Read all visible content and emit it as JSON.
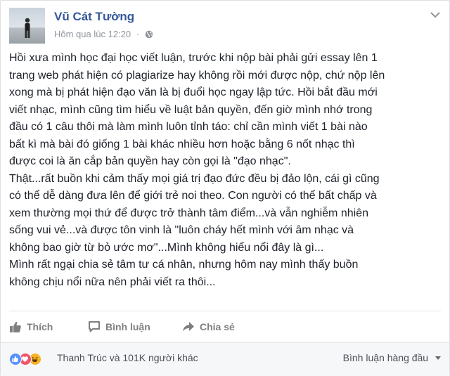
{
  "post": {
    "author_name": "Vũ Cát Tường",
    "timestamp": "Hôm qua lúc 12:20",
    "separator": "·",
    "audience_icon": "globe-icon",
    "options_icon": "chevron-down-icon",
    "body_lines": [
      "Hồi xưa mình học đại học viết luận, trước khi nộp bài phải gửi essay lên 1",
      "trang web phát hiện có plagiarize hay không rồi mới được nộp, chứ nộp lên",
      "xong mà bị phát hiện đạo văn là bị đuổi học ngay lập tức. Hồi bắt đầu mới",
      "viết nhạc, mình cũng tìm hiểu về luật bản quyền, đến giờ mình nhớ trong",
      "đầu có 1 câu thôi mà làm mình luôn tỉnh táo: chỉ cần mình viết 1 bài nào",
      "bất kì mà bài đó giống 1 bài khác nhiều hơn hoặc bằng 6 nốt nhạc thì",
      "được coi là ăn cắp bản quyền hay còn gọi là \"đạo nhạc\".",
      "Thật...rất buồn khi cảm thấy mọi giá trị đạo đức đều bị đảo lộn, cái gì cũng",
      "có thể dễ dàng đưa lên để giới trẻ noi theo. Con người có thể bất chấp và",
      "xem thường mọi thứ để được trở thành tâm điểm...và vẫn nghiễm nhiên",
      "sống vui vẻ...và được tôn vinh là \"luôn cháy hết mình với âm nhạc và",
      "không bao giờ từ bỏ ước mơ\"...Mình không hiểu nổi đây là gì...",
      "Mình rất ngại chia sẻ tâm tư cá nhân, nhưng hôm nay mình thấy buồn",
      "không chịu nổi nữa nên phải viết ra thôi..."
    ]
  },
  "actions": {
    "like_label": "Thích",
    "comment_label": "Bình luận",
    "share_label": "Chia sẻ"
  },
  "footer": {
    "reaction_icons": [
      "like-reaction-icon",
      "love-reaction-icon",
      "haha-reaction-icon"
    ],
    "likers_text": "Thanh Trúc và 101K người khác",
    "sort_label": "Bình luận hàng đầu"
  },
  "colors": {
    "author_link": "#365899",
    "meta_text": "#90949c",
    "action_text": "#7f7f7f",
    "like_reaction": "#5890ff",
    "love_reaction": "#f25268",
    "haha_reaction": "#f7b125"
  }
}
